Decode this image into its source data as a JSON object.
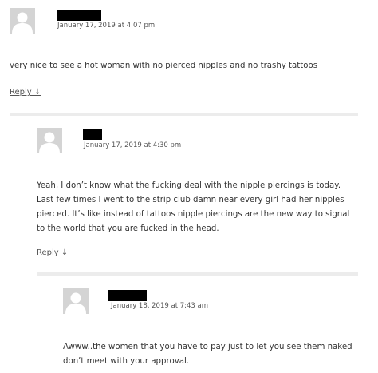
{
  "comments": [
    {
      "timestamp": "January 17, 2019 at 4:07 pm",
      "body": "very nice to see a hot woman with no pierced nipples and no trashy tattoos",
      "reply_label": "Reply ↓"
    },
    {
      "timestamp": "January 17, 2019 at 4:30 pm",
      "body": "Yeah, I don’t know what the fucking deal with the nipple piercings is today. Last few times I went to the strip club damn near every girl had her nipples pierced. It’s like instead of tattoos nipple piercings are the new way to signal to the world that you are fucked in the head.",
      "reply_label": "Reply ↓"
    },
    {
      "timestamp": "January 18, 2019 at 7:43 am",
      "body": "Awww..the women that you have to pay just to let you see them naked don’t meet with your approval."
    }
  ],
  "colors": {
    "text": "#333333",
    "meta": "#555555",
    "avatar": "#d4d4d4",
    "divider": "#ececec",
    "redaction": "#000000"
  }
}
